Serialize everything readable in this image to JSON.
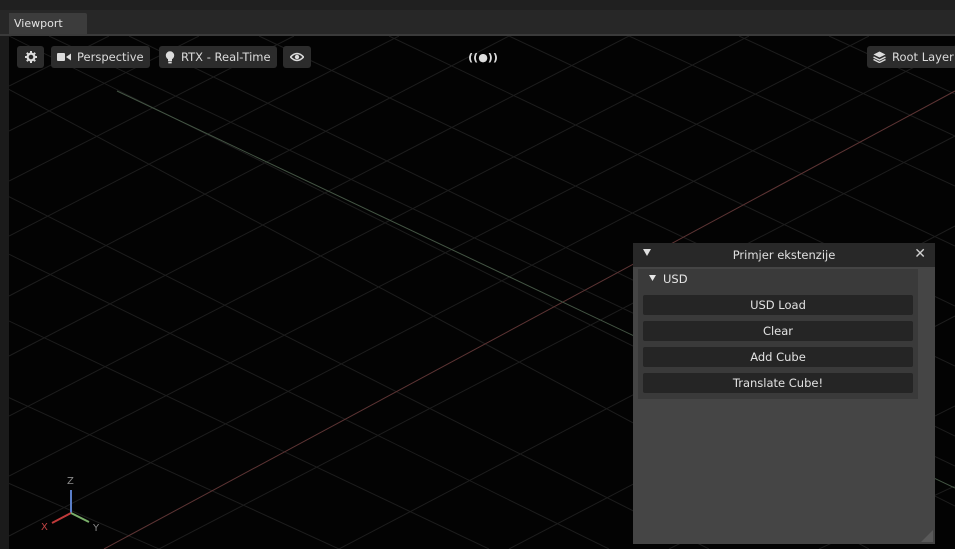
{
  "tab": {
    "label": "Viewport"
  },
  "toolbar": {
    "camera_label": "Perspective",
    "renderer_label": "RTX - Real-Time",
    "live_label": "((●))",
    "layer_label": "Root Layer"
  },
  "panel": {
    "title": "Primjer ekstenzije",
    "close_label": "✕",
    "section": {
      "label": "USD",
      "buttons": [
        {
          "label": "USD Load"
        },
        {
          "label": "Clear"
        },
        {
          "label": "Add Cube"
        },
        {
          "label": "Translate Cube!"
        }
      ]
    }
  },
  "axes": {
    "x": "X",
    "y": "Y",
    "z": "Z"
  },
  "colors": {
    "grid": "#1c1c1c",
    "x_axis_line": "#6a3b3b",
    "y_axis_line": "#4d5f4d",
    "gizmo_x": "#c03a3a",
    "gizmo_y": "#7ab06a",
    "gizmo_z": "#5a7ec8"
  }
}
